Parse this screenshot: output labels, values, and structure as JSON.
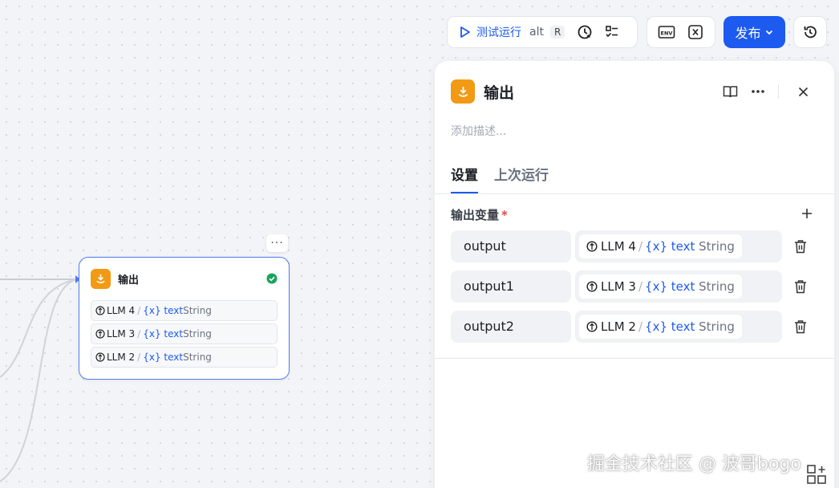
{
  "toolbar": {
    "run_label": "测试运行",
    "run_shortcut": "alt",
    "run_key": "R",
    "publish_label": "发布"
  },
  "node": {
    "title": "输出",
    "more": "···",
    "rows": [
      {
        "source": "LLM 4",
        "var": "{x} text",
        "type": "String"
      },
      {
        "source": "LLM 3",
        "var": "{x} text",
        "type": "String"
      },
      {
        "source": "LLM 2",
        "var": "{x} text",
        "type": "String"
      }
    ]
  },
  "panel": {
    "title": "输出",
    "description_placeholder": "添加描述...",
    "tabs": [
      {
        "label": "设置",
        "active": true
      },
      {
        "label": "上次运行",
        "active": false
      }
    ],
    "section_label": "输出变量",
    "required_mark": "*",
    "variables": [
      {
        "name": "output",
        "source": "LLM 4",
        "var": "{x} text",
        "type": "String"
      },
      {
        "name": "output1",
        "source": "LLM 3",
        "var": "{x} text",
        "type": "String"
      },
      {
        "name": "output2",
        "source": "LLM 2",
        "var": "{x} text",
        "type": "String"
      }
    ]
  },
  "watermark": "掘金技术社区 @ 波哥bogo",
  "colors": {
    "accent": "#1c5af0",
    "node_icon": "#f29a13",
    "success": "#1aa35a",
    "required": "#e5484d"
  },
  "icons": [
    "play-icon",
    "debug-clock-icon",
    "checklist-icon",
    "env-icon",
    "variable-icon",
    "chevron-down-icon",
    "history-icon",
    "output-node-icon",
    "check-circle-icon",
    "book-icon",
    "more-icon",
    "close-icon",
    "plus-icon",
    "trash-icon",
    "llm-source-icon",
    "minimap-icon"
  ]
}
